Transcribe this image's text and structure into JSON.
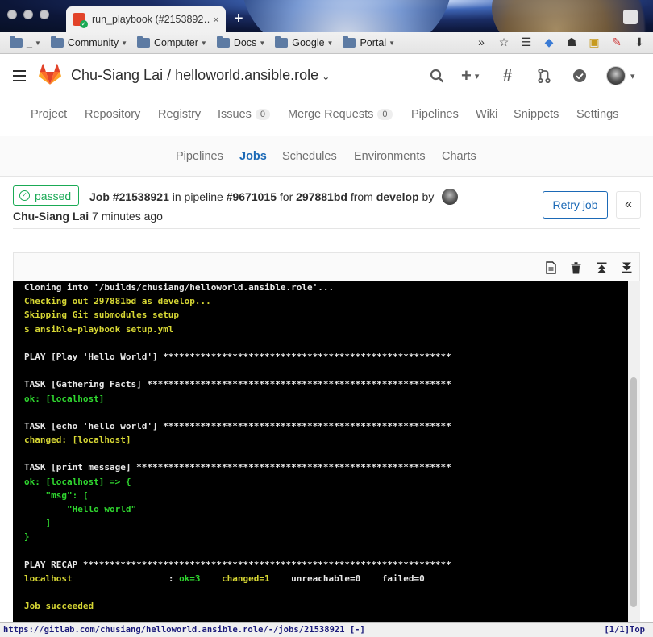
{
  "browser": {
    "tab_title": "run_playbook (#2153892…",
    "tab_close": "×",
    "new_tab": "+",
    "bookmarks": [
      {
        "label": "_"
      },
      {
        "label": "Community"
      },
      {
        "label": "Computer"
      },
      {
        "label": "Docs"
      },
      {
        "label": "Google"
      },
      {
        "label": "Portal"
      }
    ],
    "overflow": "»",
    "tool_icons": [
      "star-icon",
      "reader-icon",
      "pin-icon",
      "evernote-icon",
      "notes-icon",
      "pdf-icon",
      "download-icon"
    ]
  },
  "header": {
    "project_title": "Chu-Siang Lai / helloworld.ansible.role",
    "caret": "⌄",
    "plus_caret": "▾",
    "user_caret": "▾"
  },
  "nav": {
    "items": [
      "Project",
      "Repository",
      "Registry",
      "Issues",
      "Merge Requests",
      "Pipelines",
      "Wiki",
      "Snippets",
      "Settings"
    ],
    "issues_count": "0",
    "mr_count": "0"
  },
  "subnav": {
    "items": [
      "Pipelines",
      "Jobs",
      "Schedules",
      "Environments",
      "Charts"
    ],
    "active": "Jobs"
  },
  "job": {
    "status": "passed",
    "label": "Job",
    "id": "#21538921",
    "in_pipeline": "in pipeline",
    "pipeline_id": "#9671015",
    "for": "for",
    "commit": "297881bd",
    "from": "from",
    "branch": "develop",
    "by": "by",
    "author": "Chu-Siang Lai",
    "time_ago": "7 minutes ago",
    "retry_label": "Retry job",
    "collapse_label": "«"
  },
  "log": {
    "lines": [
      {
        "text": "Cloning into '/builds/chusiang/helloworld.ansible.role'...",
        "color": "w"
      },
      {
        "text": "Checking out 297881bd as develop...",
        "color": "y"
      },
      {
        "text": "Skipping Git submodules setup",
        "color": "y"
      },
      {
        "text": "$ ansible-playbook setup.yml",
        "color": "y"
      },
      {
        "text": "",
        "color": "w"
      },
      {
        "text": "PLAY [Play 'Hello World'] ******************************************************",
        "color": "w"
      },
      {
        "text": "",
        "color": "w"
      },
      {
        "text": "TASK [Gathering Facts] *********************************************************",
        "color": "w"
      },
      {
        "text": "ok: [localhost]",
        "color": "g"
      },
      {
        "text": "",
        "color": "w"
      },
      {
        "text": "TASK [echo 'hello world'] ******************************************************",
        "color": "w"
      },
      {
        "text": "changed: [localhost]",
        "color": "y"
      },
      {
        "text": "",
        "color": "w"
      },
      {
        "text": "TASK [print message] ***********************************************************",
        "color": "w"
      },
      {
        "text": "ok: [localhost] => {",
        "color": "g"
      },
      {
        "text": "    \"msg\": [",
        "color": "g"
      },
      {
        "text": "        \"Hello world\"",
        "color": "g"
      },
      {
        "text": "    ]",
        "color": "g"
      },
      {
        "text": "}",
        "color": "g"
      },
      {
        "text": "",
        "color": "w"
      },
      {
        "text": "PLAY RECAP *********************************************************************",
        "color": "w"
      },
      {
        "segments": [
          {
            "text": "localhost                  ",
            "color": "y"
          },
          {
            "text": ": ",
            "color": "w"
          },
          {
            "text": "ok=3    ",
            "color": "g"
          },
          {
            "text": "changed=1    ",
            "color": "y"
          },
          {
            "text": "unreachable=0    failed=0",
            "color": "w"
          }
        ]
      },
      {
        "text": "",
        "color": "w"
      },
      {
        "text": "Job succeeded",
        "color": "y"
      }
    ]
  },
  "statusbar": {
    "url": "https://gitlab.com/chusiang/helloworld.ansible.role/-/jobs/21538921 [-]",
    "right": "[1/1]Top"
  },
  "colors": {
    "gitlab_orange": "#e24329",
    "passed_green": "#1aaa55",
    "link_blue": "#1b69b6",
    "log_bg": "#000000",
    "log_yellow": "#d7d734",
    "log_green": "#2fd62f"
  }
}
